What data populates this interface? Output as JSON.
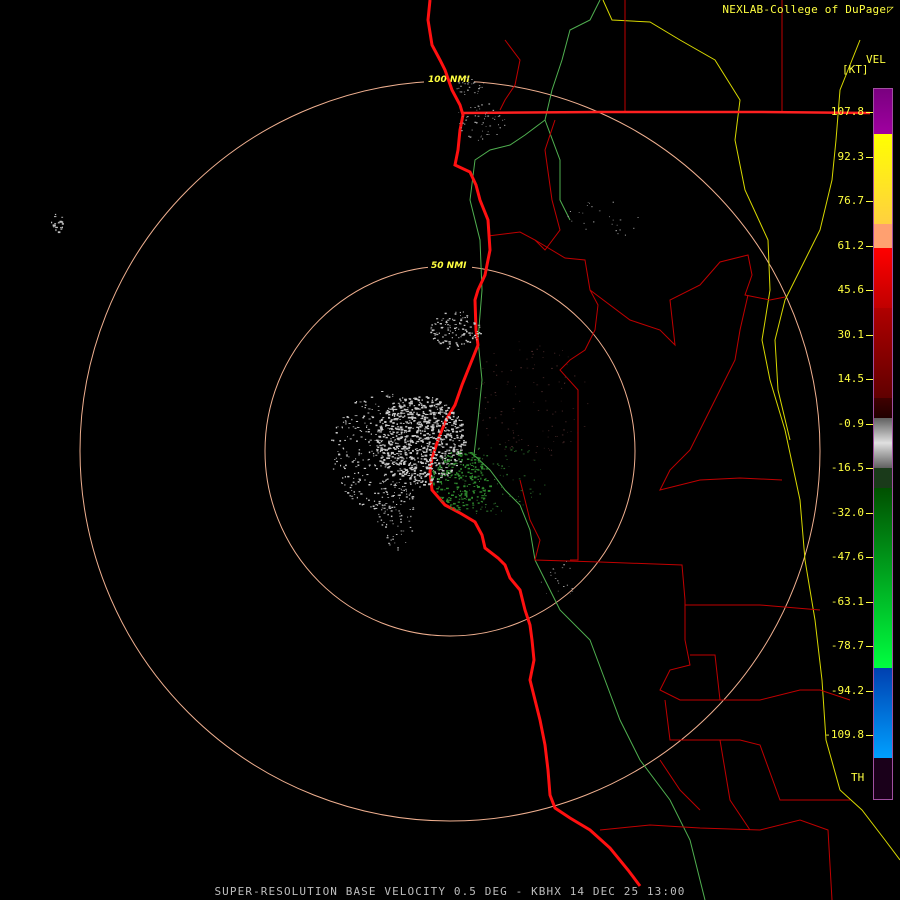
{
  "credit": "NEXLAB-College of DuPage",
  "credit_icon": "nexlab-triangle-icon",
  "legend": {
    "units": "[KT]",
    "product": "VEL",
    "ticks": [
      "107.8",
      "92.3",
      "76.7",
      "61.2",
      "45.6",
      "30.1",
      "14.5",
      "-0.9",
      "-16.5",
      "-32.0",
      "-47.6",
      "-63.1",
      "-78.7",
      "-94.2",
      "-109.8"
    ],
    "th_label": "TH",
    "colors": {
      "purple": "#800080",
      "yellow": "#ffff00",
      "orange": "#ffa060",
      "red": "#ff0000",
      "dark_red": "#700000",
      "gray": "#b0b0b0",
      "dark_green": "#004000",
      "green": "#00ff40",
      "blue": "#0050c0",
      "light_blue": "#00b0ff",
      "th_purple": "#300030"
    }
  },
  "rings": [
    "100 NMI",
    "50 NMI"
  ],
  "footer": "SUPER-RESOLUTION BASE VELOCITY 0.5 DEG - KBHX 14 DEC 25 13:00",
  "map_colors": {
    "coast": "#ff2020",
    "borders": "#cc0000",
    "rivers": "#60c060",
    "zones": "#e0e000",
    "rings": "#f0b090",
    "echo_gray": "#c8c8c8",
    "echo_green": "#2e8b2e"
  }
}
